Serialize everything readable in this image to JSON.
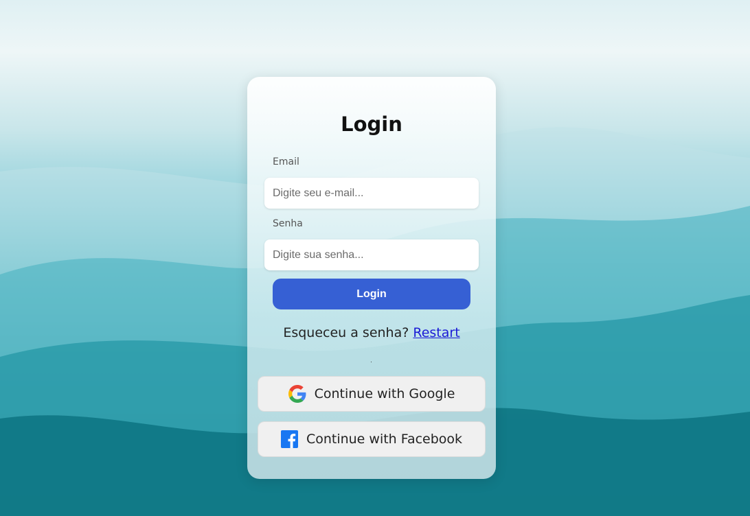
{
  "login_form": {
    "title": "Login",
    "email_label": "Email",
    "email_placeholder": "Digite seu e-mail...",
    "email_value": "",
    "password_label": "Senha",
    "password_placeholder": "Digite sua senha...",
    "password_value": "",
    "submit_label": "Login",
    "forgot_text": "Esqueceu a senha?",
    "restart_link": "Restart"
  },
  "social": {
    "google_label": "Continue with Google",
    "google_icon": "google-icon",
    "facebook_label": "Continue with Facebook",
    "facebook_icon": "facebook-icon"
  },
  "colors": {
    "primary_button": "#3660d4",
    "link": "#1a1ad6",
    "facebook_blue": "#1877f2"
  }
}
